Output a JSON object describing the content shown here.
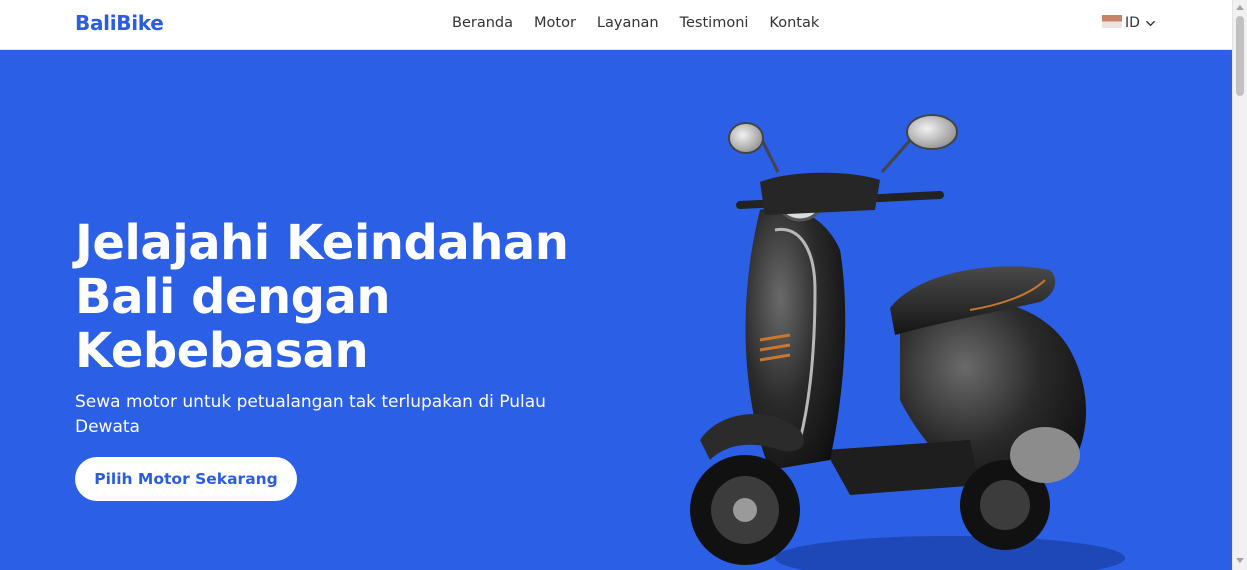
{
  "header": {
    "logo": "BaliBike",
    "nav": [
      {
        "label": "Beranda"
      },
      {
        "label": "Motor"
      },
      {
        "label": "Layanan"
      },
      {
        "label": "Testimoni"
      },
      {
        "label": "Kontak"
      }
    ],
    "language": {
      "label": "ID",
      "flag_icon": "indonesia-flag-icon",
      "chevron_icon": "chevron-down-icon"
    }
  },
  "hero": {
    "title": "Jelajahi Keindahan Bali dengan Kebebasan",
    "subtitle": "Sewa motor untuk petualangan tak terlupakan di Pulau Dewata",
    "cta_label": "Pilih Motor Sekarang",
    "image_icon": "scooter-image"
  },
  "colors": {
    "brand": "#2a5de1",
    "hero_background": "#2a5fe6",
    "text_dark": "#333333",
    "white": "#ffffff"
  }
}
